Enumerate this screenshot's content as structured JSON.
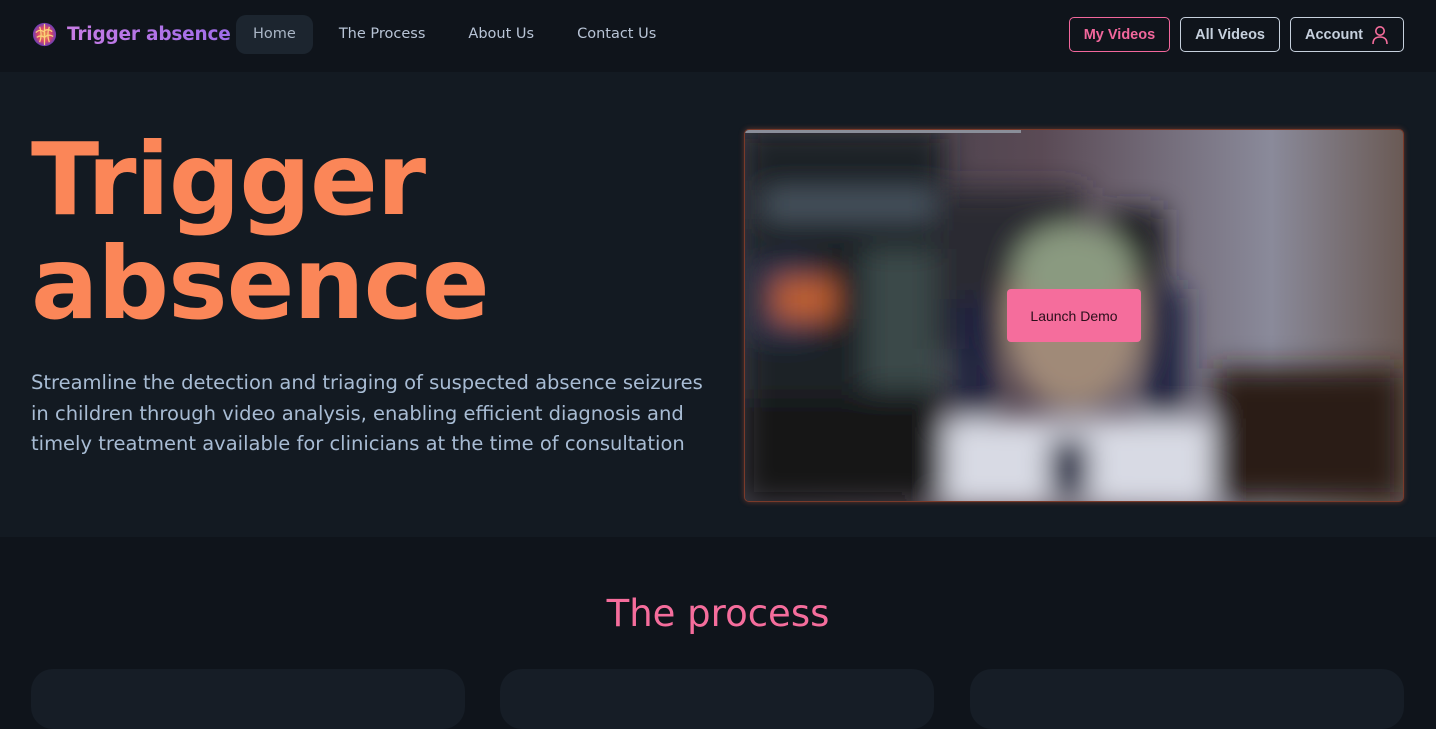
{
  "brand": {
    "name": "Trigger absence",
    "logo_icon": "brain-icon"
  },
  "nav": {
    "links": [
      {
        "label": "Home",
        "active": true
      },
      {
        "label": "The Process",
        "active": false
      },
      {
        "label": "About Us",
        "active": false
      },
      {
        "label": "Contact Us",
        "active": false
      }
    ],
    "my_videos": "My Videos",
    "all_videos": "All Videos",
    "account": "Account",
    "account_icon": "user-icon"
  },
  "hero": {
    "title_line1": "Trigger",
    "title_line2": "absence",
    "description": "Streamline the detection and triaging of suspected absence seizures in children through video analysis, enabling efficient diagnosis and timely treatment available for clinicians at the time of consultation",
    "video": {
      "launch_label": "Launch Demo",
      "progress": 0.42
    }
  },
  "process": {
    "title": "The process"
  },
  "colors": {
    "accent_pink": "#f56d9c",
    "accent_orange": "#fb8658",
    "brand_purple": "#b072e8",
    "background": "#0f141b",
    "hero_background": "#131a22"
  }
}
